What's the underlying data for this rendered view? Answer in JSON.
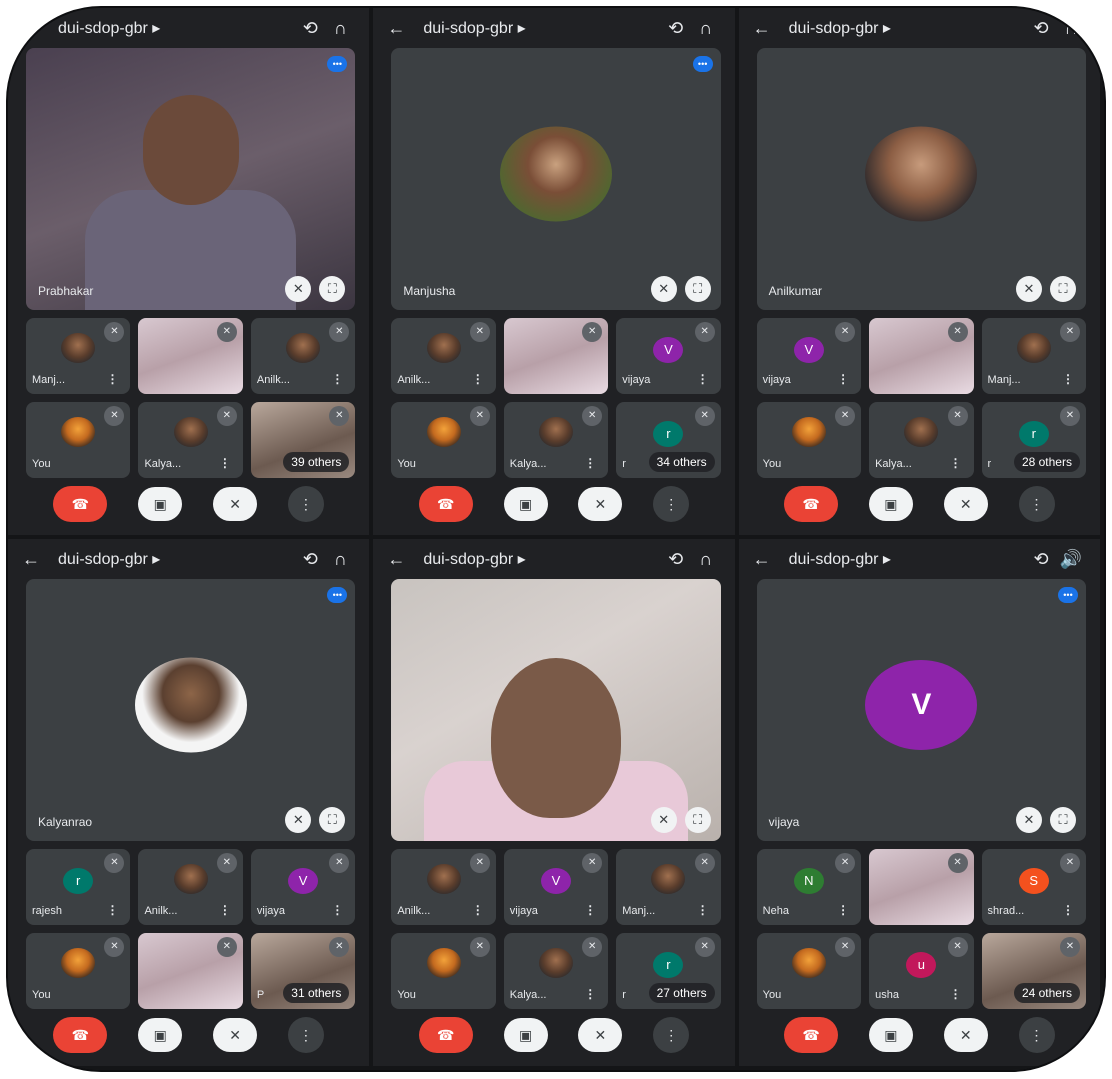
{
  "meeting_code": "dui-sdop-gbr ▸",
  "icons": {
    "back": "arrow-back-icon",
    "switch_camera": "switch-camera-icon",
    "audio": "headphones-icon",
    "speaker": "speaker-icon"
  },
  "controls": {
    "end": "☎",
    "camera": "▣",
    "mic": "✕",
    "more": "⋮"
  },
  "phones": [
    {
      "main": {
        "name": "Prabhakar",
        "kind": "video",
        "speaking": true
      },
      "tiles": [
        {
          "name": "Manj...",
          "kind": "avatar"
        },
        {
          "name": "",
          "kind": "photo"
        },
        {
          "name": "Anilk...",
          "kind": "avatar"
        },
        {
          "name": "You",
          "kind": "tiger"
        },
        {
          "name": "Kalya...",
          "kind": "avatar"
        },
        {
          "name": "",
          "kind": "photo2",
          "others": "39 others"
        }
      ]
    },
    {
      "main": {
        "name": "Manjusha",
        "kind": "avatar",
        "speaking": true
      },
      "tiles": [
        {
          "name": "Anilk...",
          "kind": "avatar"
        },
        {
          "name": "",
          "kind": "photo"
        },
        {
          "name": "vijaya",
          "kind": "letter",
          "letter": "V",
          "color": "#8e24aa"
        },
        {
          "name": "You",
          "kind": "tiger"
        },
        {
          "name": "Kalya...",
          "kind": "avatar"
        },
        {
          "name": "r",
          "kind": "letter",
          "letter": "r",
          "color": "#00796b",
          "others": "34 others"
        }
      ]
    },
    {
      "main": {
        "name": "Anilkumar",
        "kind": "avatar",
        "speaking": false
      },
      "tiles": [
        {
          "name": "vijaya",
          "kind": "letter",
          "letter": "V",
          "color": "#8e24aa"
        },
        {
          "name": "",
          "kind": "photo"
        },
        {
          "name": "Manj...",
          "kind": "avatar"
        },
        {
          "name": "You",
          "kind": "tiger"
        },
        {
          "name": "Kalya...",
          "kind": "avatar"
        },
        {
          "name": "r",
          "kind": "letter",
          "letter": "r",
          "color": "#00796b",
          "others": "28 others"
        }
      ]
    },
    {
      "main": {
        "name": "Kalyanrao",
        "kind": "avatar",
        "speaking": true
      },
      "tiles": [
        {
          "name": "rajesh",
          "kind": "letter",
          "letter": "r",
          "color": "#00796b"
        },
        {
          "name": "Anilk...",
          "kind": "avatar"
        },
        {
          "name": "vijaya",
          "kind": "letter",
          "letter": "V",
          "color": "#8e24aa"
        },
        {
          "name": "You",
          "kind": "tiger"
        },
        {
          "name": "",
          "kind": "photo"
        },
        {
          "name": "P",
          "kind": "photo2",
          "others": "31 others"
        }
      ]
    },
    {
      "main": {
        "name": "",
        "kind": "video2",
        "speaking": false
      },
      "tiles": [
        {
          "name": "Anilk...",
          "kind": "avatar"
        },
        {
          "name": "vijaya",
          "kind": "letter",
          "letter": "V",
          "color": "#8e24aa"
        },
        {
          "name": "Manj...",
          "kind": "avatar"
        },
        {
          "name": "You",
          "kind": "tiger"
        },
        {
          "name": "Kalya...",
          "kind": "avatar"
        },
        {
          "name": "r",
          "kind": "letter",
          "letter": "r",
          "color": "#00796b",
          "others": "27 others"
        }
      ]
    },
    {
      "main": {
        "name": "vijaya",
        "kind": "letter",
        "letter": "V",
        "speaking": true
      },
      "tiles": [
        {
          "name": "Neha",
          "kind": "letter",
          "letter": "N",
          "color": "#2e7d32"
        },
        {
          "name": "",
          "kind": "photo"
        },
        {
          "name": "shrad...",
          "kind": "letter",
          "letter": "S",
          "color": "#f4511e"
        },
        {
          "name": "You",
          "kind": "tiger"
        },
        {
          "name": "usha",
          "kind": "letter",
          "letter": "u",
          "color": "#c2185b"
        },
        {
          "name": "",
          "kind": "photo2",
          "others": "24 others"
        }
      ]
    }
  ]
}
